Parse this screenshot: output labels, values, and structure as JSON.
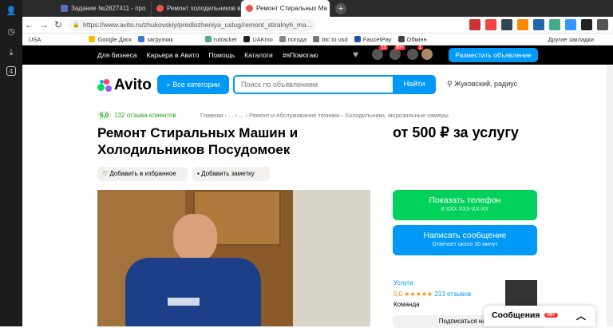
{
  "browser": {
    "tabs": [
      {
        "label": "Задание №2827411 - про"
      },
      {
        "label": "Ремонт холодильников в"
      },
      {
        "label": "Ремонт Стиральных Ма"
      }
    ],
    "url": "https://www.avito.ru/zhukovskiy/predlozheniya_uslug/remont_stiralnyh_ma...",
    "bookmarks": [
      "USA",
      "Google Диск",
      "загрузчик",
      "rutracker",
      "UAKino",
      "погода",
      "btc to usd",
      "FaucetPay",
      "Обмінн"
    ],
    "other_bookmarks": "Другие закладки",
    "badges": {
      "fav": "12",
      "msg": "99+",
      "notif": "1"
    }
  },
  "avito": {
    "top_links": [
      "Для бизнеса",
      "Карьера в Авито",
      "Помощь",
      "Каталоги",
      "#яПомогаю"
    ],
    "post_button": "Разместить объявление",
    "logo": "Avito",
    "categories_button": "Все категории",
    "search_placeholder": "Поиск по объявлениям",
    "find_button": "Найти",
    "location": "Жуковский, радиус",
    "rating": "5,0",
    "reviews": "132 отзыва клиентов",
    "breadcrumbs": "Главная  ›  ...  ›  ...  ›  Ремонт и обслуживание техники  ›  Холодильники, морозильные камеры",
    "title": "Ремонт Стиральных Машин и Холодильников Посудомоек",
    "price": "от 500 ₽ за услугу",
    "fav_button": "Добавить в избранное",
    "note_button": "Добавить заметку",
    "show_phone": "Показать телефон",
    "phone_mask": "8 XXX XXX-XX-XX",
    "write_message": "Написать сообщение",
    "reply_time": "Отвечает около 30 минут",
    "seller_name": "Услуги",
    "seller_rating": "5,0 ★★★★★",
    "seller_reviews": "213 отзывов",
    "seller_type": "Команда",
    "subscribe": "Подписаться на про",
    "messages_panel": "Сообщения",
    "messages_badge": "99+"
  }
}
